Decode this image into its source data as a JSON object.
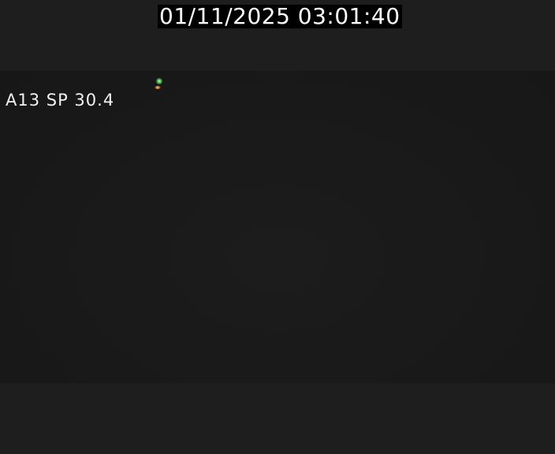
{
  "overlay": {
    "timestamp": "01/11/2025 03:01:40",
    "camera_label": "A13 SP 30.4"
  },
  "colors": {
    "background": "#1e1e1e",
    "scene": "#181818",
    "timestamp_bg": "#000000",
    "text": "#ffffff",
    "light_green": "#3fa64a",
    "light_orange": "#a05a20"
  }
}
